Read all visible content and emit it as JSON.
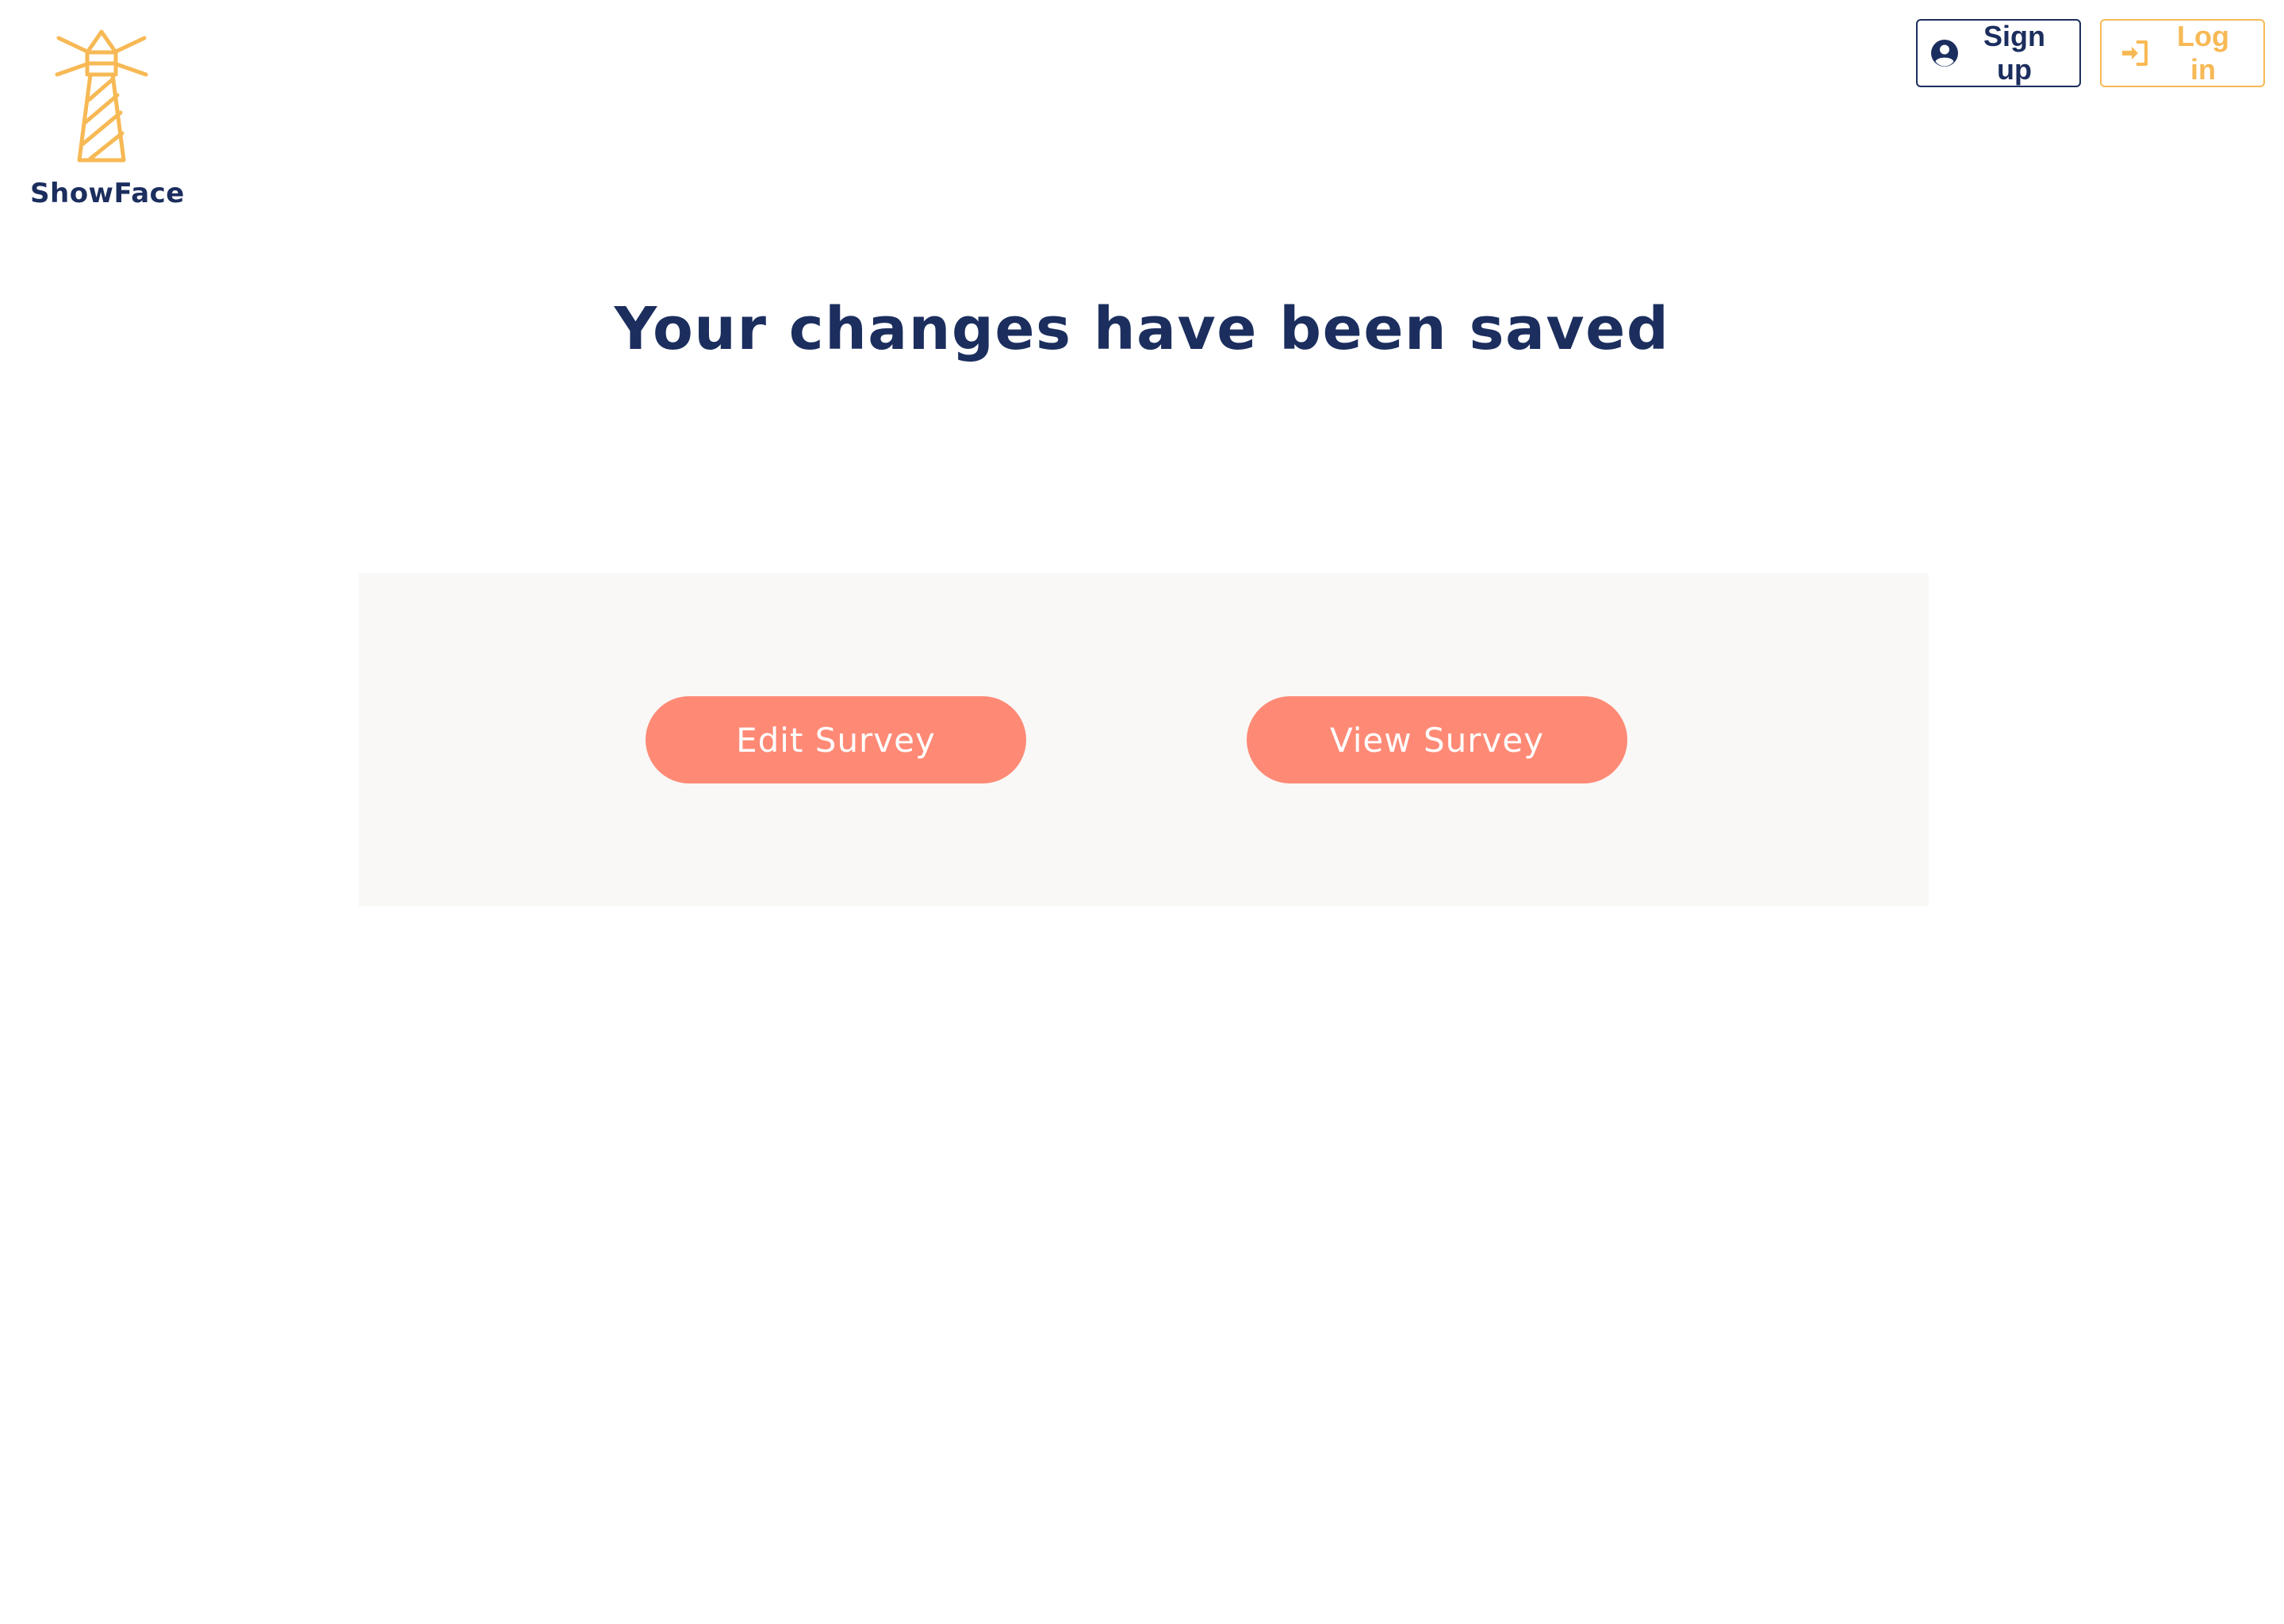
{
  "brand": {
    "name": "ShowFace",
    "logo_icon": "lighthouse-icon",
    "logo_color": "#f7b955"
  },
  "header": {
    "signup_label": "Sign up",
    "signup_icon": "user-circle-icon",
    "login_label": "Log in",
    "login_icon": "sign-in-icon"
  },
  "main": {
    "heading": "Your changes have been saved",
    "edit_label": "Edit Survey",
    "view_label": "View Survey"
  },
  "colors": {
    "navy": "#1b2e5e",
    "amber": "#f7b955",
    "coral": "#fe8a76",
    "panel_bg": "#f9f8f6"
  }
}
